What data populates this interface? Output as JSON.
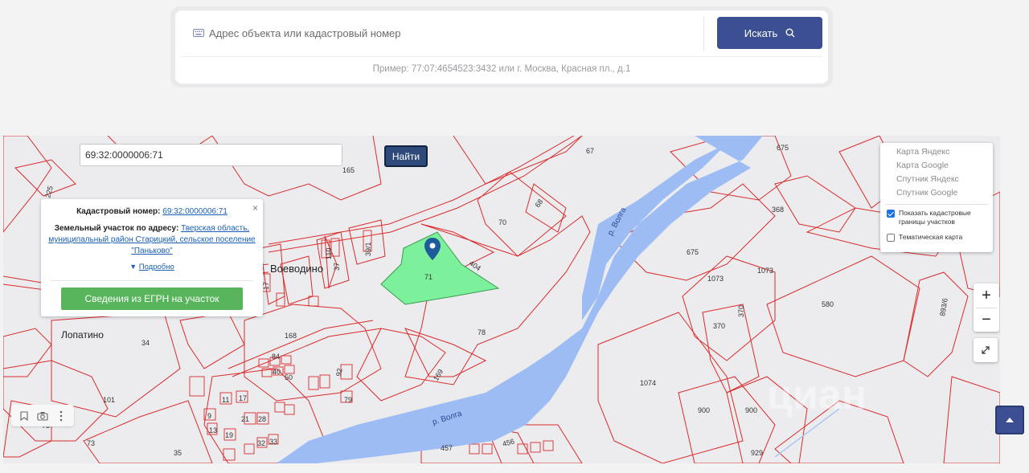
{
  "search": {
    "placeholder": "Адрес объекта или кадастровый номер",
    "button_label": "Искать",
    "example": "Пример: 77:07:4654523:3432 или г. Москва, Красная пл., д.1"
  },
  "map": {
    "cadastral_query": "69:32:0000006:71",
    "find_label": "Найти",
    "popup": {
      "cad_label": "Кадастровый номер:",
      "cad_number": "69:32:0000006:71",
      "address_label": "Земельный участок по адресу:",
      "address_value": "Тверская область, муниципальный район Старицкий, сельское поселение \"Паньково\"",
      "more_label": "Подробно",
      "egrn_button": "Сведения из ЕГРН на участок",
      "close": "×"
    },
    "layers": {
      "items": [
        "Карта Яндекс",
        "Карта Google",
        "Спутник Яндекс",
        "Спутник Google"
      ],
      "show_boundaries": "Показать кадастровые границы участков",
      "thematic": "Тематическая карта",
      "show_boundaries_checked": true,
      "thematic_checked": false
    },
    "zoom_in": "+",
    "zoom_out": "−",
    "place_labels": {
      "voevodino": "Воеводино",
      "lopatino": "Лопатино",
      "volga_upper": "р. Волга",
      "volga_lower": "р. Волга",
      "watermark": "циан"
    },
    "parcel_labels": {
      "p67": "67",
      "p675": "675",
      "p675b": "675",
      "p165": "165",
      "p225": "225",
      "p70": "70",
      "p68": "68",
      "p404": "404",
      "p71": "71",
      "p78": "78",
      "p368": "368",
      "p1073a": "1073",
      "p1073b": "1073",
      "p580": "580",
      "p370a": "370",
      "p370b": "370",
      "p1074": "1074",
      "p900a": "900",
      "p900b": "900",
      "p929": "929",
      "p168": "168",
      "p34": "34",
      "p101": "101",
      "p73a": "73",
      "p73b": "73",
      "p35": "35",
      "p84": "84",
      "p40": "40",
      "p50": "50",
      "p92": "92",
      "p79": "79",
      "p11": "11",
      "p17": "17",
      "p21": "21",
      "p28": "28",
      "p19": "19",
      "p32": "32",
      "p33": "33",
      "p169": "169",
      "p457": "457",
      "p456": "456",
      "p110": "110",
      "p37": "37",
      "p391": "39/1",
      "p176": "17",
      "p9": "9",
      "p13": "13",
      "p893": "893/6"
    }
  },
  "colors": {
    "primary": "#3c4f93",
    "green_button": "#58b55c",
    "river": "#9dbcf4",
    "parcel_line": "#d92b2b",
    "selected_parcel": "#7df09b"
  }
}
